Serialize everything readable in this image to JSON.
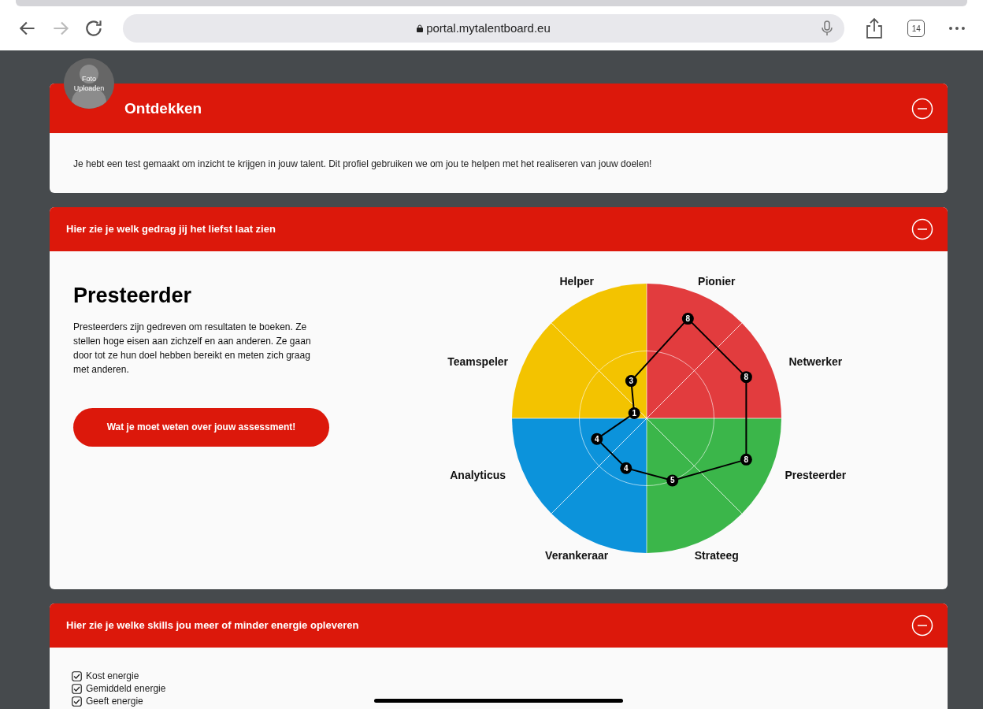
{
  "browser": {
    "url": "portal.mytalentboard.eu",
    "tab_count": "14"
  },
  "avatar": {
    "label": "Foto Uploaden"
  },
  "intro": {
    "title": "Ontdekken",
    "expanded": true,
    "text": "Je hebt een test gemaakt om inzicht te krijgen in jouw talent. Dit profiel gebruiken we om jou te helpen met het realiseren van jouw doelen!"
  },
  "behaviour": {
    "title": "Hier zie je welk gedrag jij het liefst laat zien",
    "expanded": true,
    "profile": "Presteerder",
    "description": "Presteerders zijn gedreven om resultaten te boeken. Ze stellen hoge eisen aan zichzelf en aan anderen. Ze gaan door tot ze hun doel hebben bereikt en meten zich graag met anderen.",
    "button": "Wat je moet weten over jouw assessment!",
    "radar": [
      {
        "label": "Helper",
        "score": "3",
        "color": "#f3c300"
      },
      {
        "label": "Pionier",
        "score": "8",
        "color": "#e23c3e"
      },
      {
        "label": "Teamspeler",
        "score": "1",
        "color": "#f3c300"
      },
      {
        "label": "Netwerker",
        "score": "8",
        "color": "#e23c3e"
      },
      {
        "label": "Analyticus",
        "score": "4",
        "color": "#0c93db"
      },
      {
        "label": "Presteerder",
        "score": "8",
        "color": "#3bb64a"
      },
      {
        "label": "Verankeraar",
        "score": "4",
        "color": "#0c93db"
      },
      {
        "label": "Strateeg",
        "score": "5",
        "color": "#3bb64a"
      }
    ]
  },
  "skills": {
    "title": "Hier zie je welke skills jou meer of minder energie opleveren",
    "expanded": true,
    "filters": [
      {
        "label": "Kost energie",
        "checked": true
      },
      {
        "label": "Gemiddeld energie",
        "checked": true
      },
      {
        "label": "Geeft energie",
        "checked": true
      }
    ]
  }
}
